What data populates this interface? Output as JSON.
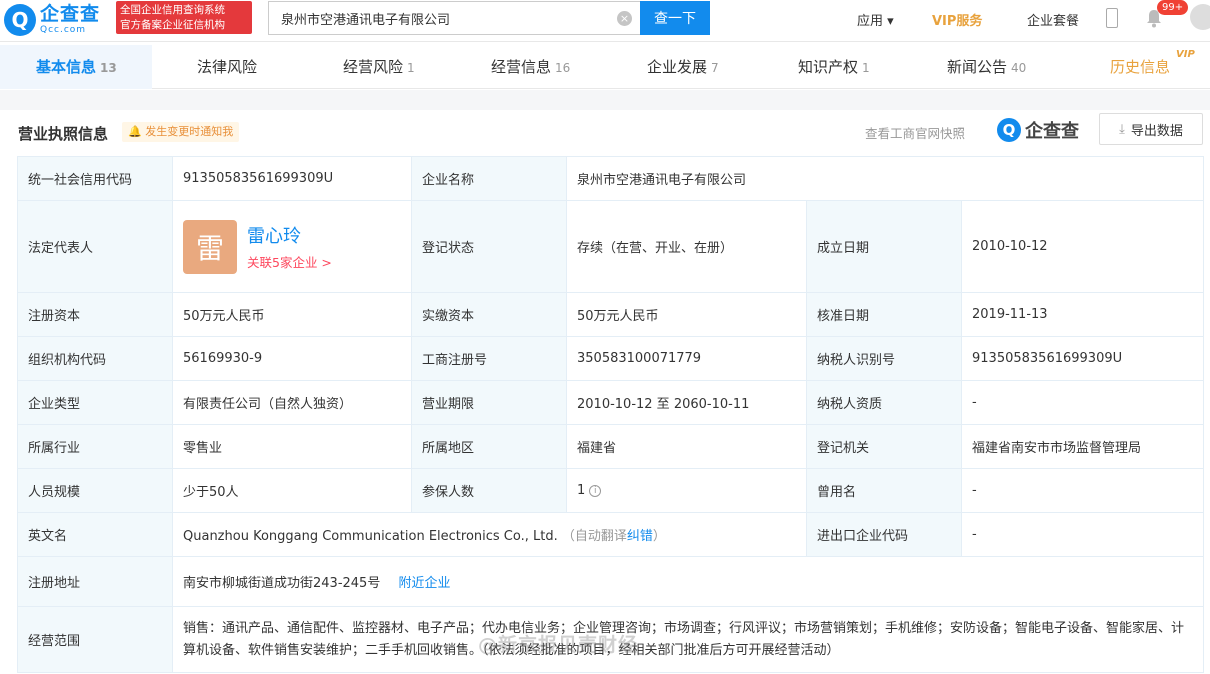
{
  "header": {
    "logo_cn": "企查查",
    "logo_en": "Qcc.com",
    "logo_mark": "Q",
    "slogan_line1": "全国企业信用查询系统",
    "slogan_line2": "官方备案企业征信机构",
    "search_value": "泉州市空港通讯电子有限公司",
    "search_button": "查一下",
    "nav_app": "应用",
    "nav_vip": "VIP服务",
    "nav_package": "企业套餐",
    "notification_badge": "99+"
  },
  "tabs": [
    {
      "label": "基本信息",
      "count": "13"
    },
    {
      "label": "法律风险",
      "count": ""
    },
    {
      "label": "经营风险",
      "count": "1"
    },
    {
      "label": "经营信息",
      "count": "16"
    },
    {
      "label": "企业发展",
      "count": "7"
    },
    {
      "label": "知识产权",
      "count": "1"
    },
    {
      "label": "新闻公告",
      "count": "40"
    },
    {
      "label": "历史信息",
      "count": ""
    }
  ],
  "vip_tag": "VIP",
  "section": {
    "title": "营业执照信息",
    "notify": "发生变更时通知我",
    "snapshot": "查看工商官网快照",
    "qcc_logo": "企查查",
    "export": "导出数据"
  },
  "table": {
    "credit_code_label": "统一社会信用代码",
    "credit_code": "91350583561699309U",
    "name_label": "企业名称",
    "name": "泉州市空港通讯电子有限公司",
    "legal_label": "法定代表人",
    "legal_avatar": "雷",
    "legal_name": "雷心玲",
    "legal_link": "关联5家企业 >",
    "status_label": "登记状态",
    "status": "存续（在营、开业、在册）",
    "found_label": "成立日期",
    "found": "2010-10-12",
    "capital_label": "注册资本",
    "capital": "50万元人民币",
    "paid_label": "实缴资本",
    "paid": "50万元人民币",
    "approve_label": "核准日期",
    "approve": "2019-11-13",
    "org_label": "组织机构代码",
    "org": "56169930-9",
    "reg_no_label": "工商注册号",
    "reg_no": "350583100071779",
    "tax_label": "纳税人识别号",
    "tax": "91350583561699309U",
    "type_label": "企业类型",
    "type": "有限责任公司（自然人独资）",
    "term_label": "营业期限",
    "term": "2010-10-12 至 2060-10-11",
    "tax_qual_label": "纳税人资质",
    "tax_qual": "-",
    "industry_label": "所属行业",
    "industry": "零售业",
    "region_label": "所属地区",
    "region": "福建省",
    "authority_label": "登记机关",
    "authority": "福建省南安市市场监督管理局",
    "staff_label": "人员规模",
    "staff": "少于50人",
    "insured_label": "参保人数",
    "insured": "1",
    "former_label": "曾用名",
    "former": "-",
    "en_label": "英文名",
    "en_name": "Quanzhou Konggang Communication Electronics Co., Ltd.",
    "en_note": "（自动翻译",
    "en_fix": "纠错",
    "en_close": "）",
    "import_label": "进出口企业代码",
    "import": "-",
    "address_label": "注册地址",
    "address": "南安市柳城街道成功街243-245号",
    "nearby": "附近企业",
    "scope_label": "经营范围",
    "scope": "销售：通讯产品、通信配件、监控器材、电子产品；代办电信业务；企业管理咨询；市场调查；行风评议；市场营销策划；手机维修；安防设备；智能电子设备、智能家居、计算机设备、软件销售安装维护；二手手机回收销售。（依法须经批准的项目，经相关部门批准后方可开展经营活动）"
  },
  "watermark": "@新京报贝壳财经"
}
